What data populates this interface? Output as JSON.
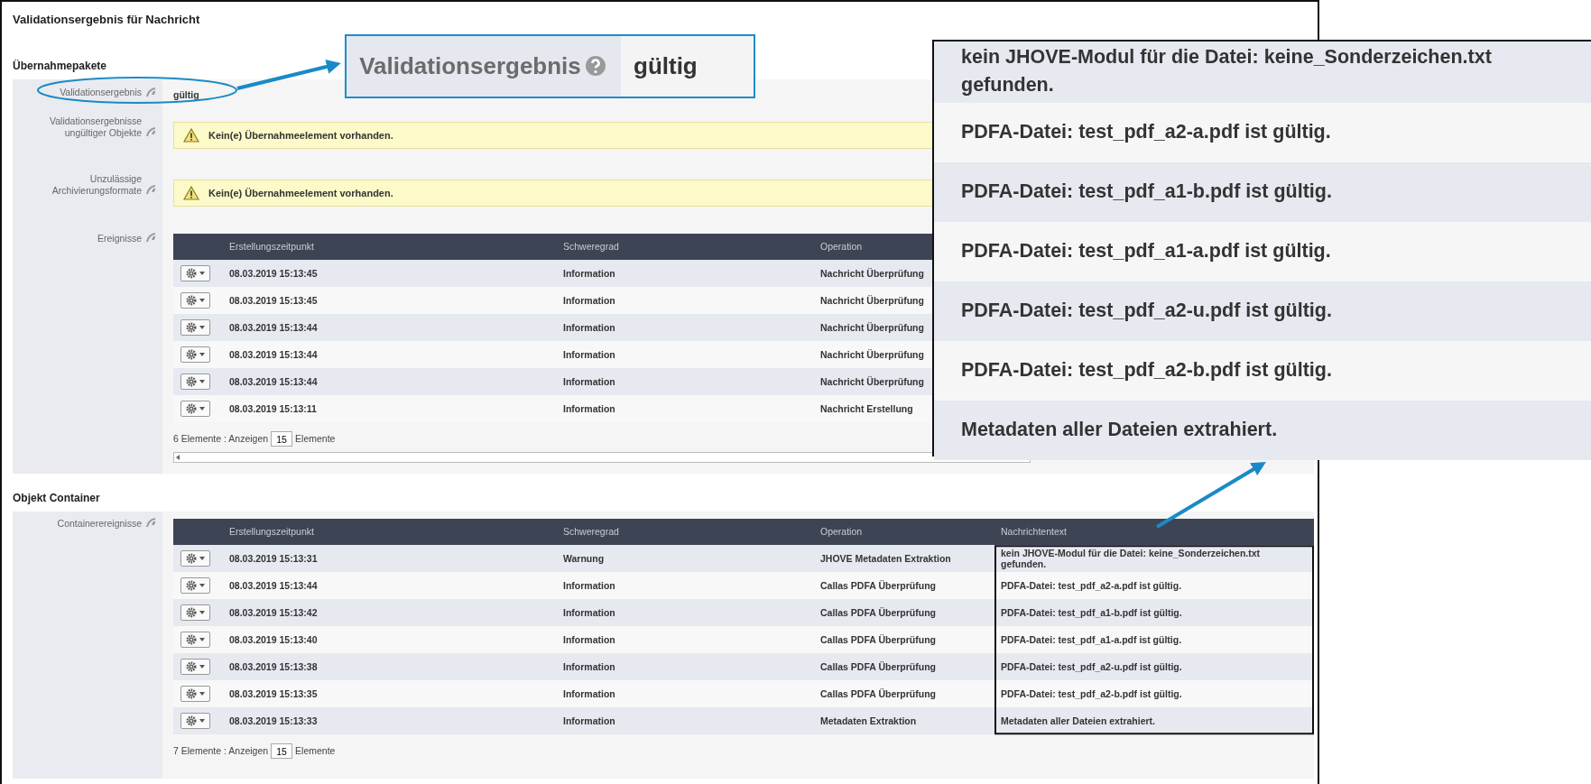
{
  "title": "Validationsergebnis für Nachricht",
  "sections": [
    {
      "heading": "Übernahmepakete",
      "fields": [
        {
          "kind": "value",
          "label": "Validationsergebnis",
          "value": "gültig"
        },
        {
          "kind": "alert",
          "label": "Validationsergebnisse ungültiger Objekte",
          "message": "Kein(e) Übernahmeelement vorhanden."
        },
        {
          "kind": "alert",
          "label": "Unzulässige Archivierungsformate",
          "message": "Kein(e) Übernahmeelement vorhanden."
        },
        {
          "kind": "table",
          "label": "Ereignisse",
          "scrollbar": true,
          "columns": [
            "Erstellungszeitpunkt",
            "Schweregrad",
            "Operation"
          ],
          "rows": [
            [
              "08.03.2019 15:13:45",
              "Information",
              "Nachricht Überprüfung"
            ],
            [
              "08.03.2019 15:13:45",
              "Information",
              "Nachricht Überprüfung"
            ],
            [
              "08.03.2019 15:13:44",
              "Information",
              "Nachricht Überprüfung"
            ],
            [
              "08.03.2019 15:13:44",
              "Information",
              "Nachricht Überprüfung"
            ],
            [
              "08.03.2019 15:13:44",
              "Information",
              "Nachricht Überprüfung"
            ],
            [
              "08.03.2019 15:13:11",
              "Information",
              "Nachricht Erstellung"
            ]
          ],
          "footer": {
            "count_text": "6 Elemente : Anzeigen",
            "page_size": "15",
            "unit": "Elemente"
          }
        }
      ]
    },
    {
      "heading": "Objekt Container",
      "fields": [
        {
          "kind": "table",
          "label": "Containerereignisse",
          "columns": [
            "Erstellungszeitpunkt",
            "Schweregrad",
            "Operation",
            "Nachrichtentext"
          ],
          "rows": [
            [
              "08.03.2019 15:13:31",
              "Warnung",
              "JHOVE Metadaten Extraktion",
              "kein JHOVE-Modul für die Datei: keine_Sonderzeichen.txt gefunden."
            ],
            [
              "08.03.2019 15:13:44",
              "Information",
              "Callas PDFA Überprüfung",
              "PDFA-Datei: test_pdf_a2-a.pdf ist gültig."
            ],
            [
              "08.03.2019 15:13:42",
              "Information",
              "Callas PDFA Überprüfung",
              "PDFA-Datei: test_pdf_a1-b.pdf ist gültig."
            ],
            [
              "08.03.2019 15:13:40",
              "Information",
              "Callas PDFA Überprüfung",
              "PDFA-Datei: test_pdf_a1-a.pdf ist gültig."
            ],
            [
              "08.03.2019 15:13:38",
              "Information",
              "Callas PDFA Überprüfung",
              "PDFA-Datei: test_pdf_a2-u.pdf ist gültig."
            ],
            [
              "08.03.2019 15:13:35",
              "Information",
              "Callas PDFA Überprüfung",
              "PDFA-Datei: test_pdf_a2-b.pdf ist gültig."
            ],
            [
              "08.03.2019 15:13:33",
              "Information",
              "Metadaten Extraktion",
              "Metadaten aller Dateien extrahiert."
            ]
          ],
          "footer": {
            "count_text": "7 Elemente : Anzeigen",
            "page_size": "15",
            "unit": "Elemente"
          }
        }
      ]
    }
  ],
  "callouts": [
    {
      "kind": "field",
      "label": "Validationsergebnis",
      "value": "gültig"
    },
    {
      "kind": "messages",
      "items": [
        "kein JHOVE-Modul für die Datei: keine_Sonderzeichen.txt gefunden.",
        "PDFA-Datei: test_pdf_a2-a.pdf ist gültig.",
        "PDFA-Datei: test_pdf_a1-b.pdf ist gültig.",
        "PDFA-Datei: test_pdf_a1-a.pdf ist gültig.",
        "PDFA-Datei: test_pdf_a2-u.pdf ist gültig.",
        "PDFA-Datei: test_pdf_a2-b.pdf ist gültig.",
        "Metadaten aller Dateien extrahiert."
      ]
    }
  ]
}
